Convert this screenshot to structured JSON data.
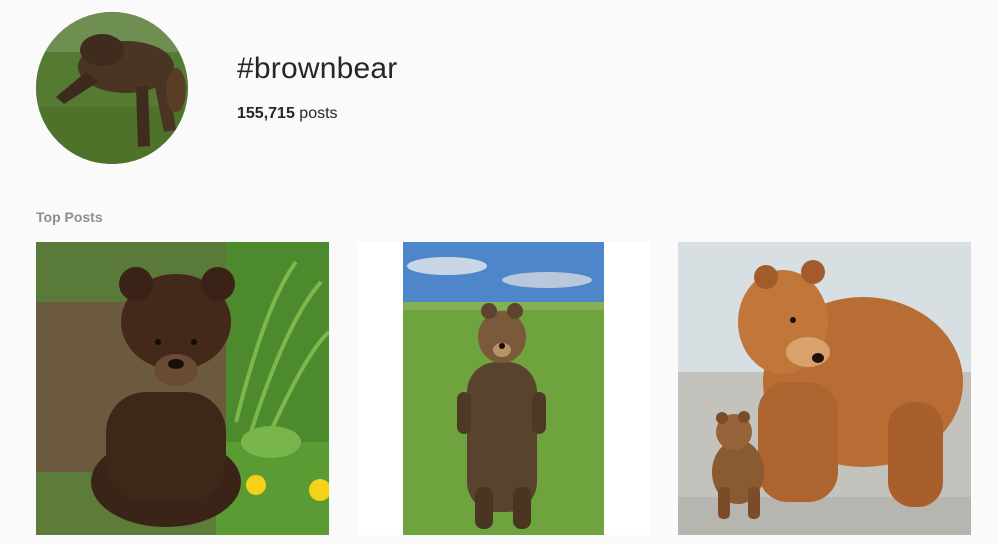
{
  "header": {
    "hashtag": "#brownbear",
    "post_count": "155,715",
    "post_count_unit": "posts",
    "avatar_icon": "dog-photo-avatar"
  },
  "top_posts": {
    "label": "Top Posts",
    "items": [
      {
        "subject": "cinnamon-bear-cub-photo"
      },
      {
        "subject": "standing-bear-cub-photo"
      },
      {
        "subject": "brown-bear-with-cub-photo"
      }
    ]
  }
}
